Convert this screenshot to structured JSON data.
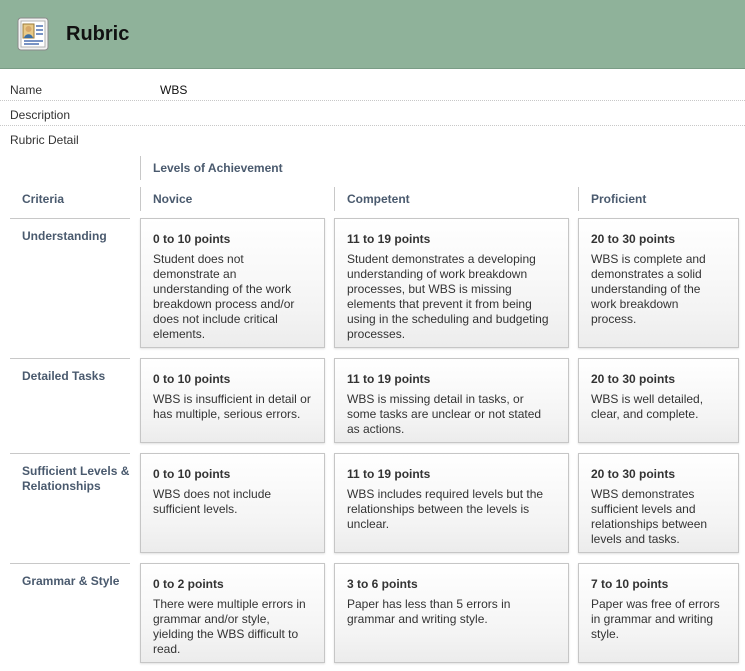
{
  "header": {
    "title": "Rubric",
    "icon": "rubric-document-icon"
  },
  "meta": [
    {
      "label": "Name",
      "value": "WBS"
    },
    {
      "label": "Description",
      "value": ""
    },
    {
      "label": "Rubric Detail",
      "value": ""
    }
  ],
  "table": {
    "group_header": "Levels of Achievement",
    "criteria_header": "Criteria",
    "levels": [
      "Novice",
      "Competent",
      "Proficient"
    ],
    "rows": [
      {
        "criterion": "Understanding",
        "cells": [
          {
            "points": "0 to 10 points",
            "desc": "Student does not demonstrate an understanding of the work breakdown process and/or does not include critical elements."
          },
          {
            "points": "11 to 19 points",
            "desc": "Student demonstrates a developing understanding of work breakdown processes, but WBS is missing elements that prevent it from being using in the scheduling and budgeting processes."
          },
          {
            "points": "20 to 30 points",
            "desc": "WBS is complete and demonstrates a solid understanding of the work breakdown process."
          }
        ]
      },
      {
        "criterion": "Detailed Tasks",
        "cells": [
          {
            "points": "0 to 10 points",
            "desc": "WBS is insufficient in detail or has multiple, serious errors."
          },
          {
            "points": "11 to 19 points",
            "desc": "WBS is missing detail in tasks, or some tasks are unclear or not stated as actions."
          },
          {
            "points": "20 to 30 points",
            "desc": "WBS is well detailed, clear, and complete."
          }
        ]
      },
      {
        "criterion": "Sufficient Levels & Relationships",
        "cells": [
          {
            "points": "0 to 10 points",
            "desc": "WBS does not include sufficient levels."
          },
          {
            "points": "11 to 19 points",
            "desc": "WBS includes required levels but the relationships between the levels is unclear."
          },
          {
            "points": "20 to 30 points",
            "desc": "WBS demonstrates sufficient levels and relationships between levels and tasks."
          }
        ]
      },
      {
        "criterion": "Grammar & Style",
        "cells": [
          {
            "points": "0 to 2 points",
            "desc": "There were multiple errors in grammar and/or style, yielding the WBS difficult to read."
          },
          {
            "points": "3 to 6 points",
            "desc": "Paper has less than 5 errors in grammar and writing style."
          },
          {
            "points": "7 to 10 points",
            "desc": "Paper was free of errors in grammar and writing style."
          }
        ]
      }
    ]
  }
}
